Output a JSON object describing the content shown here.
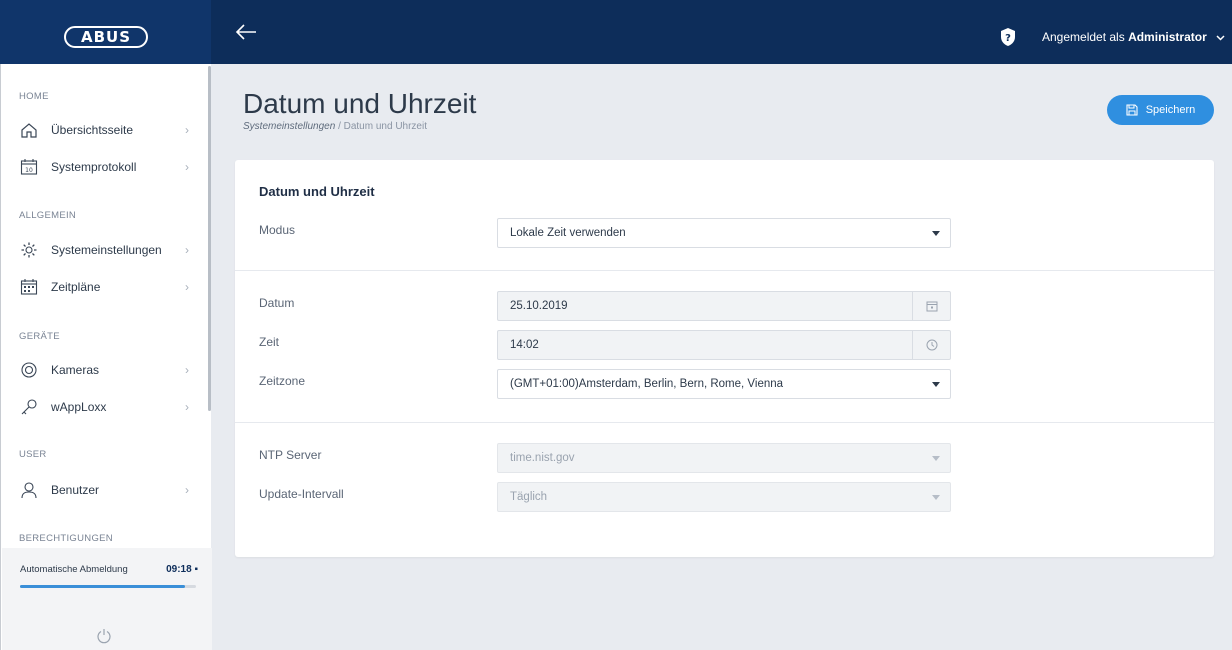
{
  "header": {
    "logo_text": "ABUS",
    "user_prefix": "Angemeldet als",
    "user_name": "Administrator"
  },
  "sidebar": {
    "sections": [
      {
        "label": "HOME"
      },
      {
        "label": "ALLGEMEIN"
      },
      {
        "label": "GERÄTE"
      },
      {
        "label": "USER"
      },
      {
        "label": "BERECHTIGUNGEN"
      }
    ],
    "items": [
      {
        "label": "Übersichtsseite",
        "icon": "home-icon"
      },
      {
        "label": "Systemprotokoll",
        "icon": "calendar-icon",
        "icon_text": "10"
      },
      {
        "label": "Systemeinstellungen",
        "icon": "gear-icon"
      },
      {
        "label": "Zeitpläne",
        "icon": "schedule-icon"
      },
      {
        "label": "Kameras",
        "icon": "camera-icon"
      },
      {
        "label": "wAppLoxx",
        "icon": "key-icon"
      },
      {
        "label": "Benutzer",
        "icon": "user-icon"
      }
    ],
    "auto_logout_label": "Automatische Abmeldung",
    "auto_logout_time": "09:18",
    "auto_logout_progress": 0.94
  },
  "page": {
    "title": "Datum und Uhrzeit",
    "breadcrumb_parent": "Systemeinstellungen",
    "breadcrumb_sep": "/",
    "breadcrumb_current": "Datum und Uhrzeit",
    "save_label": "Speichern"
  },
  "form": {
    "section_title": "Datum und Uhrzeit",
    "modus_label": "Modus",
    "modus_value": "Lokale Zeit verwenden",
    "datum_label": "Datum",
    "datum_value": "25.10.2019",
    "zeit_label": "Zeit",
    "zeit_value": "14:02",
    "zeitzone_label": "Zeitzone",
    "zeitzone_value": "(GMT+01:00)Amsterdam, Berlin, Bern, Rome, Vienna",
    "ntp_label": "NTP Server",
    "ntp_value": "time.nist.gov",
    "interval_label": "Update-Intervall",
    "interval_value": "Täglich"
  },
  "colors": {
    "topbar": "#0d2d5a",
    "accent": "#2f8fe0",
    "background": "#e8ebf0"
  }
}
